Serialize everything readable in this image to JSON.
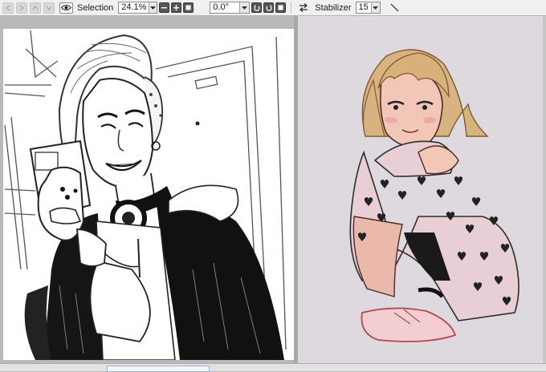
{
  "toolbar": {
    "selection_label": "Selection",
    "zoom_value": "24.1%",
    "angle_value": "0.0°",
    "stabilizer_label": "Stabilizer",
    "stabilizer_value": "15"
  },
  "icons": {
    "nav": [
      "arrow-left-icon",
      "arrow-right-icon",
      "arrow-up-icon",
      "arrow-down-icon"
    ],
    "view": "eye-icon",
    "zoom_controls": [
      "zoom-out-icon",
      "zoom-in-icon",
      "zoom-fit-icon"
    ],
    "rotate_controls": [
      "rotate-ccw-icon",
      "rotate-cw-icon",
      "rotate-reset-icon"
    ],
    "flip": "swap-arrows-icon",
    "pen": "pen-line-icon"
  },
  "colors": {
    "toolbar_bg": "#f0f0f0",
    "workspace_bg": "#b9b9b9",
    "left_canvas": "#ffffff",
    "right_canvas": "#ded9de",
    "hair": "#d8b37f",
    "skin": "#f3c7b8",
    "clothing_pink": "#e8cfd6"
  }
}
